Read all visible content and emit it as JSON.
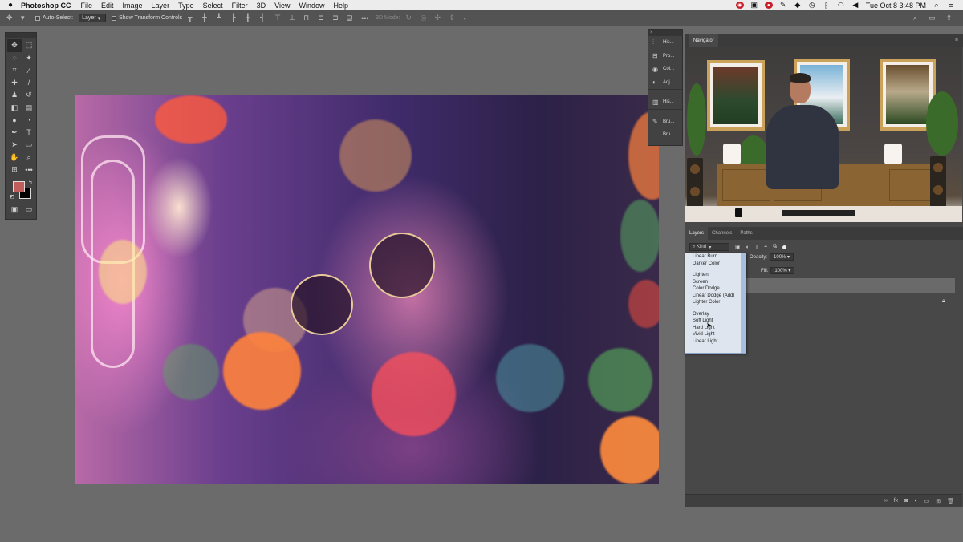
{
  "menubar": {
    "app_name": "Photoshop CC",
    "items": [
      "File",
      "Edit",
      "Image",
      "Layer",
      "Type",
      "Select",
      "Filter",
      "3D",
      "View",
      "Window",
      "Help"
    ],
    "clock": "Tue Oct 8  3:48 PM"
  },
  "options": {
    "auto_select_label": "Auto-Select:",
    "auto_select_value": "Layer",
    "transform_label": "Show Transform Controls",
    "mode_3d_label": "3D Mode:"
  },
  "strip": {
    "items": [
      {
        "icon": "histogram-icon",
        "label": "His..."
      },
      {
        "icon": "properties-icon",
        "label": "Pro..."
      },
      {
        "icon": "color-icon",
        "label": "Col..."
      },
      {
        "icon": "adjustments-icon",
        "label": "Adj..."
      },
      {
        "icon": "history-icon",
        "label": "His..."
      },
      {
        "icon": "brush-icon",
        "label": "Bru..."
      },
      {
        "icon": "brush-presets-icon",
        "label": "Bru..."
      }
    ]
  },
  "navigator": {
    "title": "Navigator"
  },
  "layers": {
    "tabs": [
      "Layers",
      "Channels",
      "Paths"
    ],
    "kind_label": "Kind",
    "opacity_label": "Opacity:",
    "opacity_value": "100%",
    "fill_label": "Fill:",
    "fill_value": "100%"
  },
  "blend_modes": {
    "group1": [
      "Linear Burn",
      "Darker Color"
    ],
    "group2": [
      "Lighten",
      "Screen",
      "Color Dodge",
      "Linear Dodge (Add)",
      "Lighter Color"
    ],
    "group3": [
      "Overlay",
      "Soft Light",
      "Hard Light",
      "Vivid Light",
      "Linear Light"
    ]
  },
  "colors": {
    "foreground": "#c15d5a",
    "background": "#000000",
    "dock_bg": "#484848",
    "ui_bg": "#535353"
  }
}
